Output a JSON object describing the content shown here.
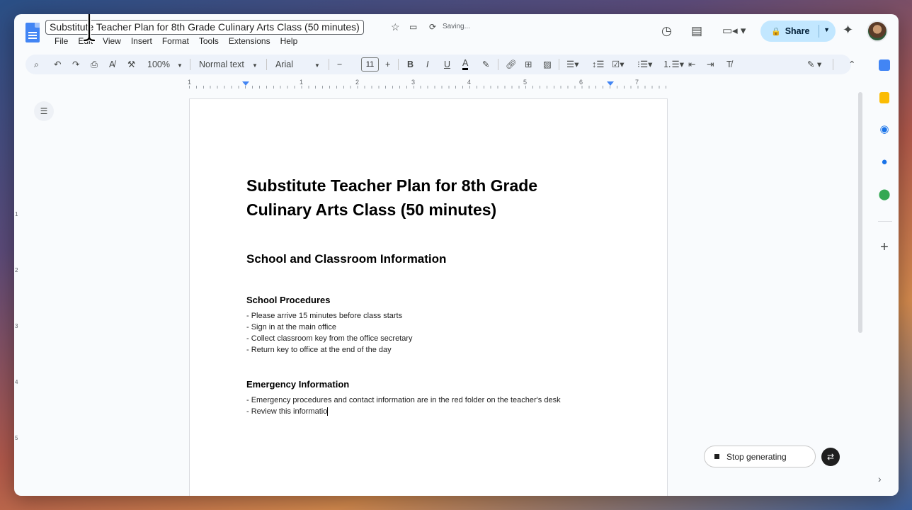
{
  "doc": {
    "title": "Substitute Teacher Plan for 8th Grade Culinary Arts Class (50 minutes)",
    "status": "Saving..."
  },
  "menu": [
    "File",
    "Edit",
    "View",
    "Insert",
    "Format",
    "Tools",
    "Extensions",
    "Help"
  ],
  "header": {
    "share_label": "Share"
  },
  "toolbar": {
    "zoom": "100%",
    "style": "Normal text",
    "font": "Arial",
    "font_size": "11"
  },
  "ruler": {
    "numbers": [
      "1",
      "1",
      "2",
      "3",
      "4",
      "5",
      "6",
      "7"
    ],
    "vnumbers": [
      "1",
      "2",
      "3",
      "4",
      "5"
    ]
  },
  "content": {
    "h1": "Substitute Teacher Plan for 8th Grade Culinary Arts Class (50 minutes)",
    "h2": "School and Classroom Information",
    "procedures_heading": "School Procedures",
    "procedures": [
      "- Please arrive 15 minutes before class starts",
      "- Sign in at the main office",
      "- Collect classroom key from the office secretary",
      "- Return key to office at the end of the day"
    ],
    "emergency_heading": "Emergency Information",
    "emergency": [
      "- Emergency procedures and contact information are in the red folder on the teacher's desk",
      "- Review this informatio"
    ]
  },
  "assistant": {
    "stop_label": "Stop generating"
  },
  "colors": {
    "accent": "#4285f4",
    "share_bg": "#c2e7ff",
    "toolbar_bg": "#edf2fa"
  },
  "icons": {
    "search": "search-icon",
    "undo": "undo-icon",
    "redo": "redo-icon",
    "print": "print-icon",
    "history": "history-icon",
    "comment": "comment-icon",
    "video": "video-icon",
    "gemini": "gemini-icon"
  }
}
